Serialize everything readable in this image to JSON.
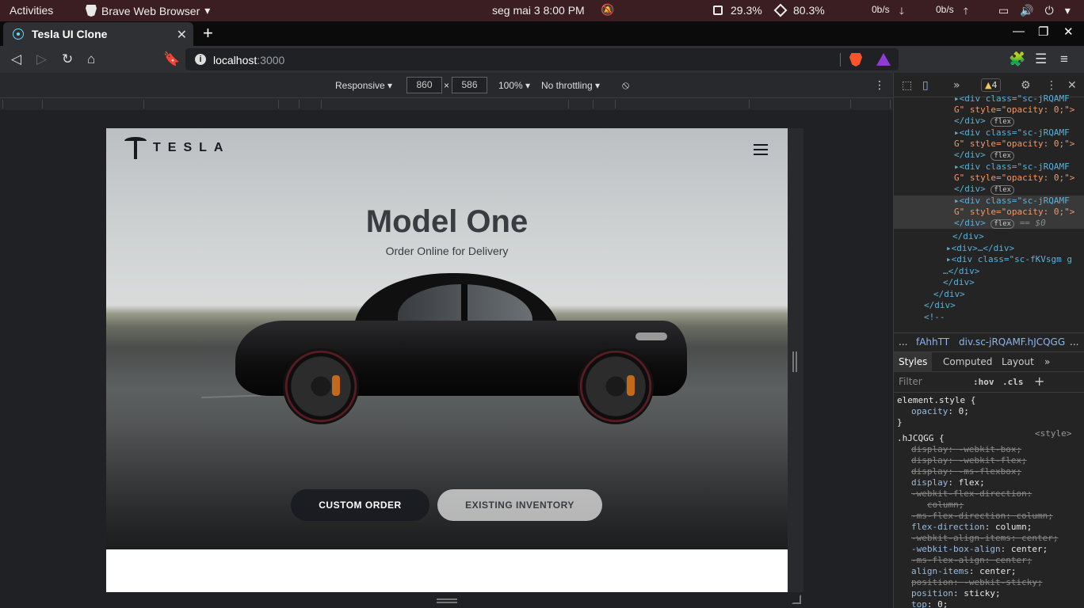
{
  "system_bar": {
    "activities": "Activities",
    "app_name": "Brave Web Browser",
    "clock": "seg mai 3   8:00 PM",
    "cpu": "29.3%",
    "memory": "80.3%",
    "net_down": "0b/s",
    "net_up": "0b/s"
  },
  "browser": {
    "tab_title": "Tesla UI Clone",
    "url_host": "localhost",
    "url_port": ":3000"
  },
  "device_toolbar": {
    "mode": "Responsive ▾",
    "width": "860",
    "height": "586",
    "times": "×",
    "zoom": "100% ▾",
    "throttling": "No throttling ▾"
  },
  "page": {
    "logo_text": "TESLA",
    "title": "Model One",
    "subtitle": "Order Online for Delivery",
    "primary_button": "CUSTOM ORDER",
    "secondary_button": "EXISTING INVENTORY"
  },
  "devtools": {
    "warnings": "4",
    "dom_lines": [
      {
        "indent": 76,
        "tag": "▸<div class=\"sc-jRQAMF",
        "cont": "G\" style=\"opacity: 0;\">",
        "close": "</div>",
        "flex": "flex"
      },
      {
        "indent": 76,
        "tag": "▸<div class=\"sc-jRQAMF",
        "cont": "G\" style=\"opacity: 0;\">",
        "close": "</div>",
        "flex": "flex"
      },
      {
        "indent": 76,
        "tag": "▸<div class=\"sc-jRQAMF",
        "cont": "G\" style=\"opacity: 0;\">",
        "close": "</div>",
        "flex": "flex"
      },
      {
        "indent": 76,
        "tag": "▸<div class=\"sc-jRQAMF",
        "cont": "G\" style=\"opacity: 0;\">",
        "close": "</div>",
        "flex": "flex"
      }
    ],
    "selected_suffix": "== $0",
    "tail_lines": [
      {
        "indent": 74,
        "text": "</div>"
      },
      {
        "indent": 66,
        "text": "▸<div>…</div>"
      },
      {
        "indent": 66,
        "text": "▸<div class=\"sc-fKVsgm g"
      },
      {
        "indent": 62,
        "text": "…</div>"
      },
      {
        "indent": 62,
        "text": "</div>"
      },
      {
        "indent": 50,
        "text": "</div>"
      },
      {
        "indent": 38,
        "text": "</div>"
      },
      {
        "indent": 38,
        "text": "<!--"
      }
    ],
    "breadcrumbs": [
      "...",
      "fAhhTT",
      "div.sc-jRQAMF.hJCQGG",
      "..."
    ],
    "tabs": [
      "Styles",
      "Computed",
      "Layout",
      "»"
    ],
    "filter_placeholder": "Filter",
    "hov": ":hov",
    "cls": ".cls",
    "styles": [
      {
        "text": "element.style {",
        "kind": "selector"
      },
      {
        "prop": "opacity",
        "val": "0;",
        "kind": "decl"
      },
      {
        "text": "}",
        "kind": "selector"
      },
      {
        "text": ".hJCQGG {",
        "kind": "selector",
        "source": "<style>"
      },
      {
        "prop": "display",
        "val": "-webkit-box;",
        "kind": "strike"
      },
      {
        "prop": "display",
        "val": "-webkit-flex;",
        "kind": "strike"
      },
      {
        "prop": "display",
        "val": "-ms-flexbox;",
        "kind": "strike"
      },
      {
        "prop": "display",
        "val": "flex;",
        "kind": "decl"
      },
      {
        "prop": "-webkit-flex-direction",
        "val": "",
        "kind": "strike"
      },
      {
        "prop": "",
        "val": "column;",
        "kind": "strike"
      },
      {
        "prop": "-ms-flex-direction",
        "val": "column;",
        "kind": "strike"
      },
      {
        "prop": "flex-direction",
        "val": "column;",
        "kind": "decl"
      },
      {
        "prop": "-webkit-align-items",
        "val": "center;",
        "kind": "strike"
      },
      {
        "prop": "-webkit-box-align",
        "val": "center;",
        "kind": "decl"
      },
      {
        "prop": "-ms-flex-align",
        "val": "center;",
        "kind": "strike"
      },
      {
        "prop": "align-items",
        "val": "center;",
        "kind": "decl"
      },
      {
        "prop": "position",
        "val": "-webkit-sticky;",
        "kind": "strike"
      },
      {
        "prop": "position",
        "val": "sticky;",
        "kind": "decl"
      },
      {
        "prop": "top",
        "val": "0;",
        "kind": "decl"
      }
    ]
  }
}
